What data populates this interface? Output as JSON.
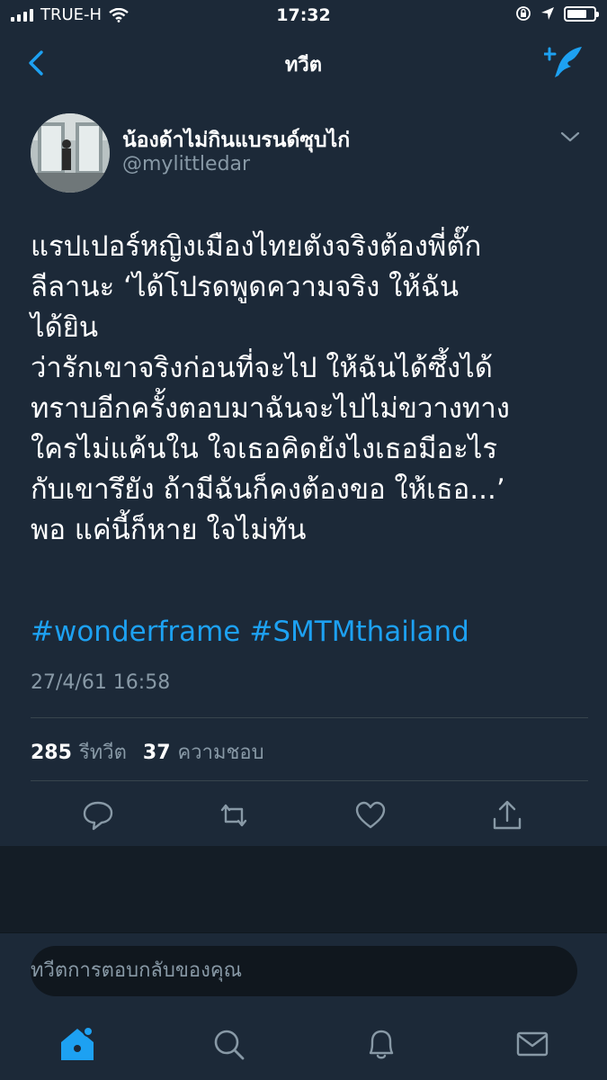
{
  "status_bar": {
    "carrier": "TRUE-H",
    "time": "17:32",
    "battery_level": 0.75,
    "icons": [
      "signal-icon",
      "wifi-icon",
      "rotation-lock-icon",
      "location-icon",
      "battery-icon"
    ]
  },
  "nav": {
    "title": "ทวีต",
    "back_icon": "chevron-left-icon",
    "compose_icon": "compose-tweet-icon"
  },
  "tweet": {
    "author_name": "น้องด้าไม่กินแบรนด์ซุบไก่",
    "author_handle": "@mylittledar",
    "text_lines": [
      "แรปเปอร์หญิงเมืองไทยตังจริงต้องพี่ตั๊ก",
      "ลีลานะ ‘ได้โปรดพูดความจริง ให้ฉัน",
      "ได้ยิน",
      "ว่ารักเขาจริงก่อนที่จะไป ให้ฉันได้ซึ้งได้",
      "ทราบอีกครั้งตอบมาฉันจะไปไม่ขวางทาง",
      " ใครไม่แค้นใน ใจเธอคิดยังไงเธอมีอะไร",
      "กับเขารึยัง ถ้ามีฉันก็คงต้องขอ ให้เธอ...’",
      "พอ แค่นี้ก็หาย ใจไม่ทัน"
    ],
    "hashtags": [
      "#wonderframe",
      "#SMTMthailand"
    ],
    "timestamp": "27/4/61 16:58",
    "retweet_count": "285",
    "retweet_label": "รีทวีต",
    "like_count": "37",
    "like_label": "ความชอบ",
    "actions": [
      "reply-icon",
      "retweet-icon",
      "like-icon",
      "share-icon"
    ]
  },
  "reply": {
    "placeholder": "ทวีตการตอบกลับของคุณ"
  },
  "tab_bar": {
    "items": [
      "home-icon",
      "search-icon",
      "notifications-icon",
      "messages-icon"
    ],
    "active": "home-icon"
  },
  "colors": {
    "background": "#141d26",
    "surface": "#1c2938",
    "accent": "#1da1f2",
    "secondary_text": "#8899a6"
  }
}
